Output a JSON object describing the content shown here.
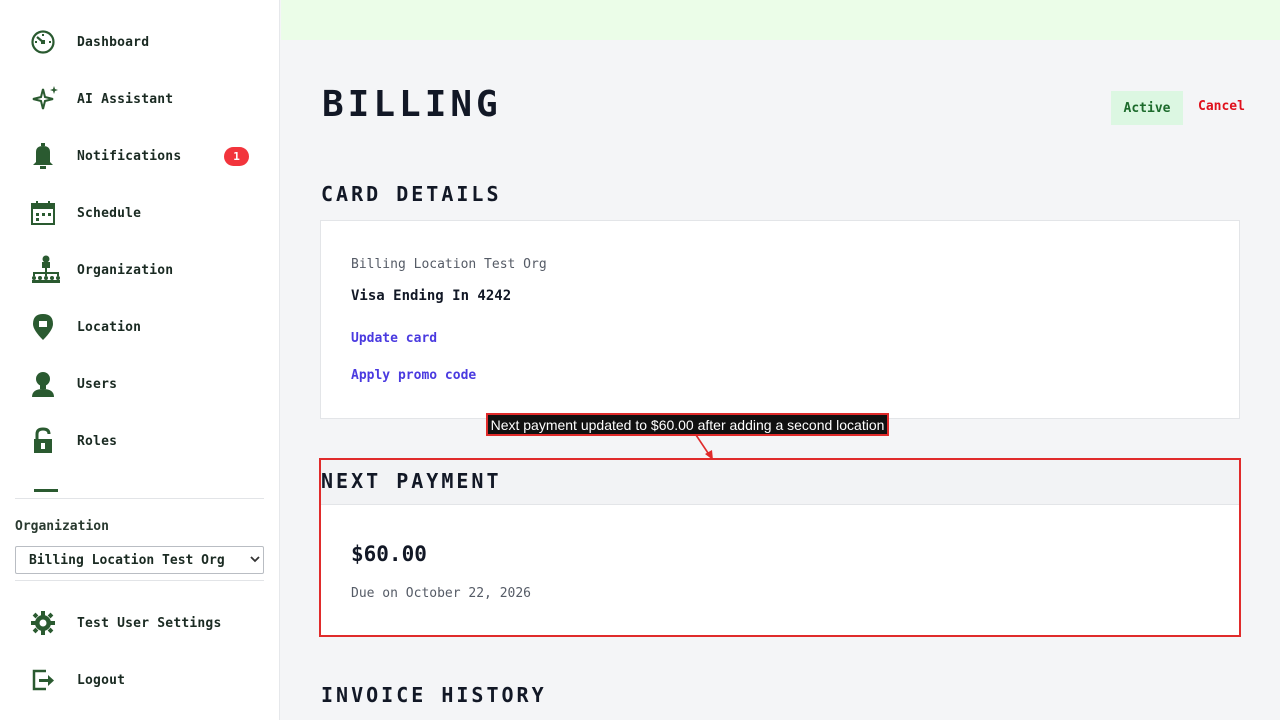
{
  "sidebar": {
    "items": [
      {
        "label": "Dashboard",
        "icon": "dashboard-icon"
      },
      {
        "label": "AI Assistant",
        "icon": "sparkle-icon"
      },
      {
        "label": "Notifications",
        "icon": "bell-icon",
        "badge": "1"
      },
      {
        "label": "Schedule",
        "icon": "calendar-icon"
      },
      {
        "label": "Organization",
        "icon": "org-chart-icon"
      },
      {
        "label": "Location",
        "icon": "map-pin-icon"
      },
      {
        "label": "Users",
        "icon": "user-icon"
      },
      {
        "label": "Roles",
        "icon": "lock-icon"
      }
    ],
    "organization_label": "Organization",
    "organization_selected": "Billing Location Test Org",
    "settings_label": "Test User Settings",
    "logout_label": "Logout"
  },
  "header": {
    "title": "BILLING",
    "status": "Active",
    "cancel": "Cancel"
  },
  "card_details": {
    "heading": "CARD DETAILS",
    "org_name": "Billing Location Test Org",
    "card": "Visa Ending In 4242",
    "update_card": "Update card",
    "apply_promo": "Apply promo code"
  },
  "next_payment": {
    "heading": "NEXT PAYMENT",
    "amount": "$60.00",
    "due": "Due on October 22, 2026"
  },
  "invoice_history": {
    "heading": "INVOICE HISTORY"
  },
  "annotation": {
    "text": "Next payment updated to $60.00 after adding a second location"
  },
  "colors": {
    "accent_green": "#2a5a30",
    "danger": "#e0101c",
    "link": "#4a3ae0",
    "badge_red": "#f2343c"
  }
}
